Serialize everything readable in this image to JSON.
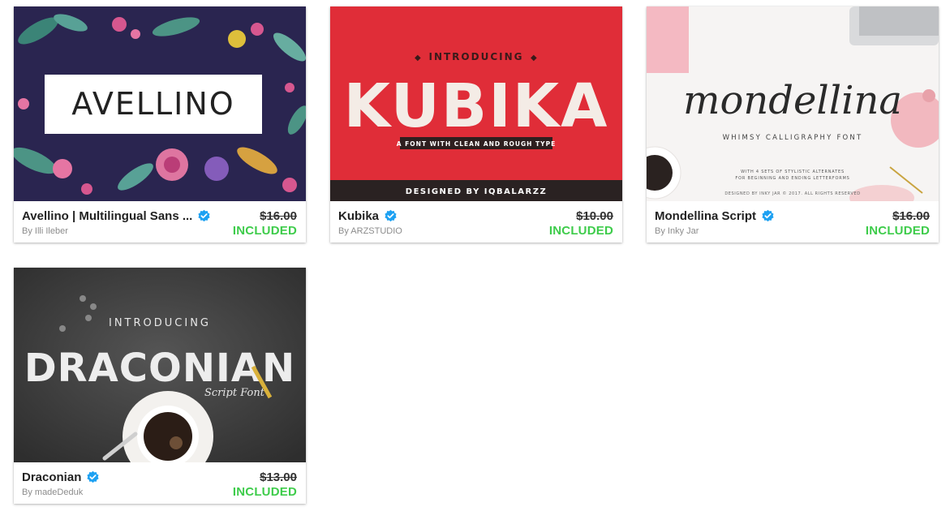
{
  "products": [
    {
      "title": "Avellino | Multilingual Sans ...",
      "author_prefix": "By",
      "author": "Illi Ileber",
      "old_price": "$16.00",
      "status": "INCLUDED",
      "preview_text": "AVELLINO"
    },
    {
      "title": "Kubika",
      "author_prefix": "By",
      "author": "ARZSTUDIO",
      "old_price": "$10.00",
      "status": "INCLUDED",
      "preview_intro": "INTRODUCING",
      "preview_text": "KUBIKA",
      "preview_tagline": "A FONT WITH CLEAN AND ROUGH TYPE",
      "preview_credit": "DESIGNED BY IQBALARZZ"
    },
    {
      "title": "Mondellina Script",
      "author_prefix": "By",
      "author": "Inky Jar",
      "old_price": "$16.00",
      "status": "INCLUDED",
      "preview_text": "mondellina",
      "preview_sub": "WHIMSY CALLIGRAPHY FONT",
      "preview_note1": "WITH 4 SETS OF STYLISTIC ALTERNATES",
      "preview_note2": "FOR BEGINNING AND ENDING LETTERFORMS",
      "preview_credit": "DESIGNED BY INKY JAR © 2017. ALL RIGHTS RESERVED"
    },
    {
      "title": "Draconian",
      "author_prefix": "By",
      "author": "madeDeduk",
      "old_price": "$13.00",
      "status": "INCLUDED",
      "preview_intro": "INTRODUCING",
      "preview_text": "DRACONIAN",
      "preview_sub": "Script Font"
    }
  ],
  "colors": {
    "included": "#3ecc4b",
    "verified": "#1da1f2",
    "kubika_red": "#e8323c",
    "avellino_bg": "#2a2550",
    "draconian_bg": "#3a3a3a"
  },
  "icons": {
    "verified": "verified-badge-icon"
  }
}
